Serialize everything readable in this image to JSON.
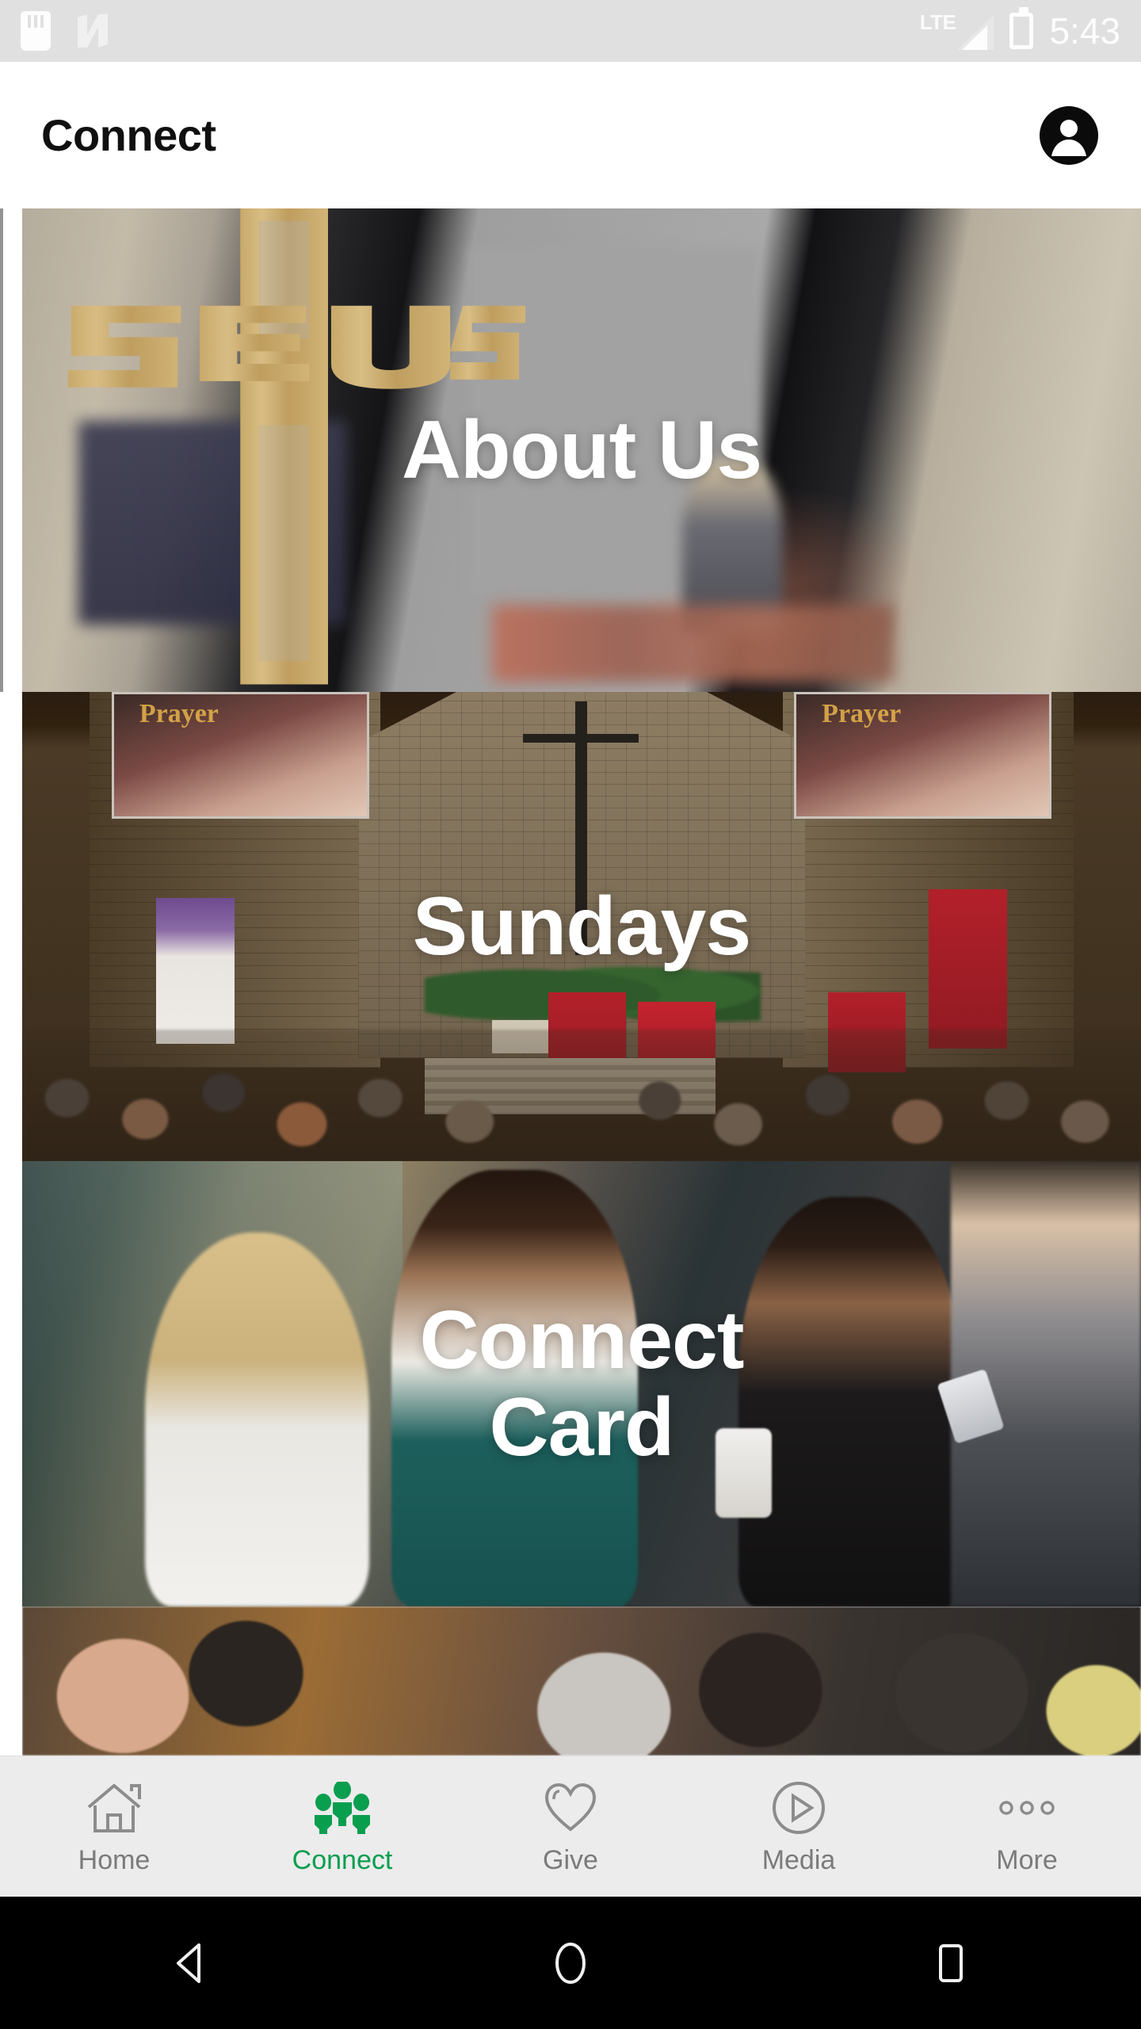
{
  "status_bar": {
    "time": "5:43",
    "network_type": "LTE",
    "icons": [
      "sd-card-icon",
      "android-nougat-icon",
      "lte-signal-icon",
      "battery-charging-icon"
    ]
  },
  "app_bar": {
    "title": "Connect",
    "account_icon": "account-circle-icon"
  },
  "cards": [
    {
      "label": "About Us",
      "icon": "church-cross-image"
    },
    {
      "label": "Sundays",
      "icon": "sanctuary-image"
    },
    {
      "label": "Connect\nCard",
      "line1": "Connect",
      "line2": "Card",
      "icon": "people-greeting-image"
    },
    {
      "label": "",
      "icon": "crowd-image"
    }
  ],
  "tab_bar": {
    "active_color": "#0a9e4f",
    "inactive_color": "#7b7b7b",
    "items": [
      {
        "label": "Home",
        "icon": "home-icon",
        "active": false
      },
      {
        "label": "Connect",
        "icon": "people-icon",
        "active": true
      },
      {
        "label": "Give",
        "icon": "heart-icon",
        "active": false
      },
      {
        "label": "Media",
        "icon": "play-circle-icon",
        "active": false
      },
      {
        "label": "More",
        "icon": "more-dots-icon",
        "active": false
      }
    ]
  },
  "system_nav": {
    "buttons": [
      {
        "name": "back-button",
        "icon": "triangle-left-icon"
      },
      {
        "name": "home-button",
        "icon": "circle-icon"
      },
      {
        "name": "recents-button",
        "icon": "square-icon"
      }
    ]
  }
}
